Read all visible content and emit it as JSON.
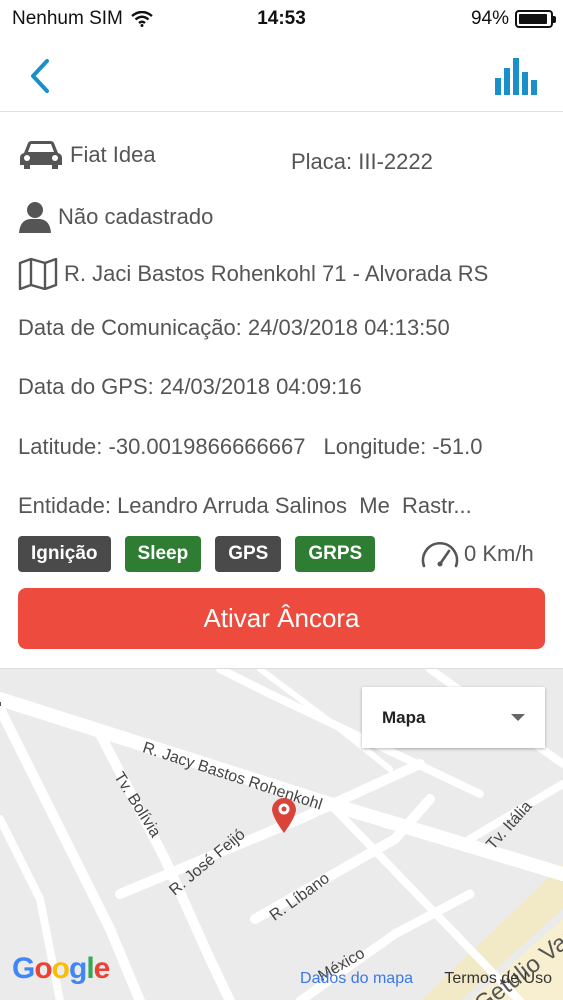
{
  "status_bar": {
    "carrier": "Nenhum SIM",
    "time": "14:53",
    "battery": "94%",
    "battery_level": 0.94
  },
  "vehicle": {
    "model": "Fiat Idea",
    "plate": "Placa: III-2222",
    "driver": "Não cadastrado",
    "address": "R. Jaci Bastos Rohenkohl 71 - Alvorada RS",
    "communication_date": "Data de Comunicação: 24/03/2018 04:13:50",
    "gps_date": "Data do GPS: 24/03/2018 04:09:16",
    "latitude": "Latitude: -30.0019866666667",
    "longitude": "Longitude: -51.0",
    "entity": "Entidade: Leandro Arruda Salinos  Me  Rastr..."
  },
  "badges": [
    {
      "label": "Ignição",
      "color": "#4a4a4a"
    },
    {
      "label": "Sleep",
      "color": "#2e7d32"
    },
    {
      "label": "GPS",
      "color": "#4a4a4a"
    },
    {
      "label": "GRPS",
      "color": "#2e7d32"
    }
  ],
  "speed": "0 Km/h",
  "anchor_button": "Ativar Âncora",
  "map": {
    "type_select": "Mapa",
    "logo": "Google",
    "data_link": "Dados do mapa",
    "terms": "Termos de Uso",
    "streets": {
      "jacy": "R. Jacy Bastos Rohenkohl",
      "bolivia": "Tv. Bolívia",
      "feijo": "R. José Feijó",
      "libano": "R. Líbano",
      "italia": "Tv. Itália",
      "getulio": "Getúlio Vargas",
      "mexico": "México"
    }
  },
  "colors": {
    "accent": "#1a8fc9",
    "anchor": "#ec4b3e",
    "badge_gray": "#4a4a4a",
    "badge_green": "#2e7d32",
    "marker": "#d9433a"
  }
}
